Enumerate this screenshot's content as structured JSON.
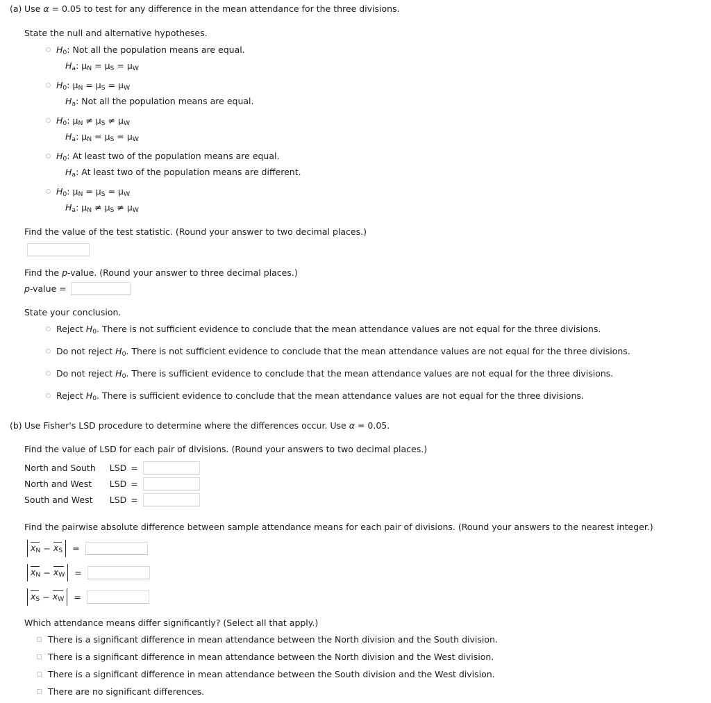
{
  "parts": {
    "a": {
      "label": "(a)",
      "stem_pre": "Use ",
      "stem_alpha": "α",
      "stem_post": " = 0.05 to test for any difference in the mean attendance for the three divisions.",
      "hypotheses_heading": "State the null and alternative hypotheses.",
      "hypothesis_options": [
        {
          "h0_label": "H",
          "h0_sub": "0",
          "h0_text": ": Not all the population means are equal.",
          "ha_label": "H",
          "ha_sub": "a",
          "ha_text": ": μN = μS = μW",
          "ha_kind": "math",
          "ha_ops": [
            "=",
            "="
          ]
        },
        {
          "h0_label": "H",
          "h0_sub": "0",
          "h0_text": ": μN = μS = μW",
          "h0_kind": "math",
          "h0_ops": [
            "=",
            "="
          ],
          "ha_label": "H",
          "ha_sub": "a",
          "ha_text": ": Not all the population means are equal.",
          "ha_kind": "text"
        },
        {
          "h0_label": "H",
          "h0_sub": "0",
          "h0_text": ": μN ≠ μS ≠ μW",
          "h0_kind": "math",
          "h0_ops": [
            "≠",
            "≠"
          ],
          "ha_label": "H",
          "ha_sub": "a",
          "ha_text": ": μN = μS = μW",
          "ha_kind": "math",
          "ha_ops": [
            "=",
            "="
          ]
        },
        {
          "h0_label": "H",
          "h0_sub": "0",
          "h0_text": ": At least two of the population means are equal.",
          "h0_kind": "text",
          "ha_label": "H",
          "ha_sub": "a",
          "ha_text": ": At least two of the population means are different.",
          "ha_kind": "text"
        },
        {
          "h0_label": "H",
          "h0_sub": "0",
          "h0_text": ": μN = μS = μW",
          "h0_kind": "math",
          "h0_ops": [
            "=",
            "="
          ],
          "ha_label": "H",
          "ha_sub": "a",
          "ha_text": ": μN ≠ μS ≠ μW",
          "ha_kind": "math",
          "ha_ops": [
            "≠",
            "≠"
          ]
        }
      ],
      "test_statistic_prompt": "Find the value of the test statistic. (Round your answer to two decimal places.)",
      "test_statistic_value": "",
      "pvalue_prompt_pre": "Find the ",
      "pvalue_prompt_italic": "p",
      "pvalue_prompt_post": "-value. (Round your answer to three decimal places.)",
      "pvalue_label_italic": "p",
      "pvalue_label_post": "-value =",
      "pvalue_value": "",
      "conclusion_heading": "State your conclusion.",
      "conclusion_options": [
        {
          "pre": "Reject ",
          "h": "H",
          "sub": "0",
          "post": ". There is not sufficient evidence to conclude that the mean attendance values are not equal for the three divisions."
        },
        {
          "pre": "Do not reject ",
          "h": "H",
          "sub": "0",
          "post": ". There is not sufficient evidence to conclude that the mean attendance values are not equal for the three divisions."
        },
        {
          "pre": "Do not reject ",
          "h": "H",
          "sub": "0",
          "post": ". There is sufficient evidence to conclude that the mean attendance values are not equal for the three divisions."
        },
        {
          "pre": "Reject ",
          "h": "H",
          "sub": "0",
          "post": ". There is sufficient evidence to conclude that the mean attendance values are not equal for the three divisions."
        }
      ]
    },
    "b": {
      "label": "(b)",
      "stem_pre": "Use Fisher's LSD procedure to determine where the differences occur. Use ",
      "stem_alpha": "α",
      "stem_post": " = 0.05.",
      "lsd_prompt": "Find the value of LSD for each pair of divisions. (Round your answers to two decimal places.)",
      "lsd_rows": [
        {
          "pair": "North and South",
          "label": "LSD",
          "eq": "=",
          "value": ""
        },
        {
          "pair": "North and West",
          "label": "LSD",
          "eq": "=",
          "value": ""
        },
        {
          "pair": "South and West",
          "label": "LSD",
          "eq": "=",
          "value": ""
        }
      ],
      "pairwise_prompt": "Find the pairwise absolute difference between sample attendance means for each pair of divisions. (Round your answers to the nearest integer.)",
      "pairwise_rows": [
        {
          "var": "x",
          "sub1": "N",
          "op": "−",
          "sub2": "S",
          "eq": "=",
          "value": ""
        },
        {
          "var": "x",
          "sub1": "N",
          "op": "−",
          "sub2": "W",
          "eq": "=",
          "value": ""
        },
        {
          "var": "x",
          "sub1": "S",
          "op": "−",
          "sub2": "W",
          "eq": "=",
          "value": ""
        }
      ],
      "differ_question": "Which attendance means differ significantly? (Select all that apply.)",
      "differ_options": [
        "There is a significant difference in mean attendance between the North division and the South division.",
        "There is a significant difference in mean attendance between the North division and the West division.",
        "There is a significant difference in mean attendance between the South division and the West division.",
        "There are no significant differences."
      ]
    }
  }
}
